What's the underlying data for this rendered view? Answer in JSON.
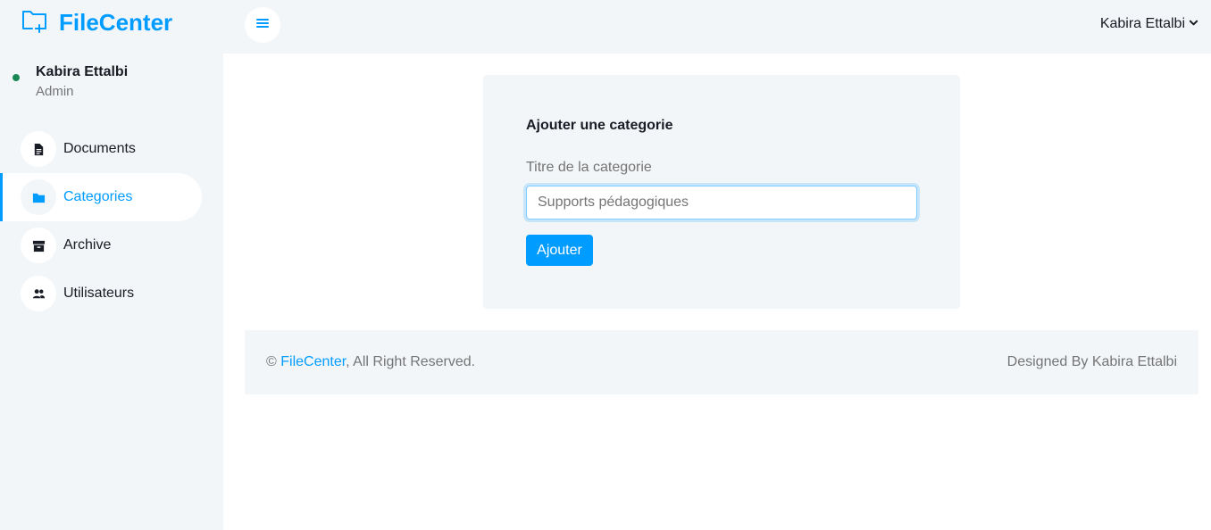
{
  "brand": {
    "name": "FileCenter",
    "icon": "folder-plus-icon",
    "color": "#009cff"
  },
  "sidebar": {
    "user": {
      "name": "Kabira Ettalbi",
      "role": "Admin",
      "status_color": "#198754"
    },
    "items": [
      {
        "label": "Documents",
        "icon": "file-alt-icon",
        "active": false
      },
      {
        "label": "Categories",
        "icon": "folder-icon",
        "active": true
      },
      {
        "label": "Archive",
        "icon": "archive-icon",
        "active": false
      },
      {
        "label": "Utilisateurs",
        "icon": "users-icon",
        "active": false
      }
    ]
  },
  "topbar": {
    "toggle_icon": "bars-icon",
    "user_menu_label": "Kabira Ettalbi",
    "user_menu_icon": "chevron-down-icon"
  },
  "form": {
    "title": "Ajouter une categorie",
    "field_label": "Titre de la categorie",
    "field_value": "Supports pédagogiques",
    "submit_label": "Ajouter"
  },
  "footer": {
    "copyright_symbol": "©",
    "link_text": "FileCenter",
    "rights_text": ", All Right Reserved.",
    "designed_by": "Designed By Kabira Ettalbi"
  },
  "colors": {
    "accent": "#009cff",
    "panel": "#f3f6f9",
    "text_dark": "#191c24",
    "text_muted": "#757575"
  }
}
